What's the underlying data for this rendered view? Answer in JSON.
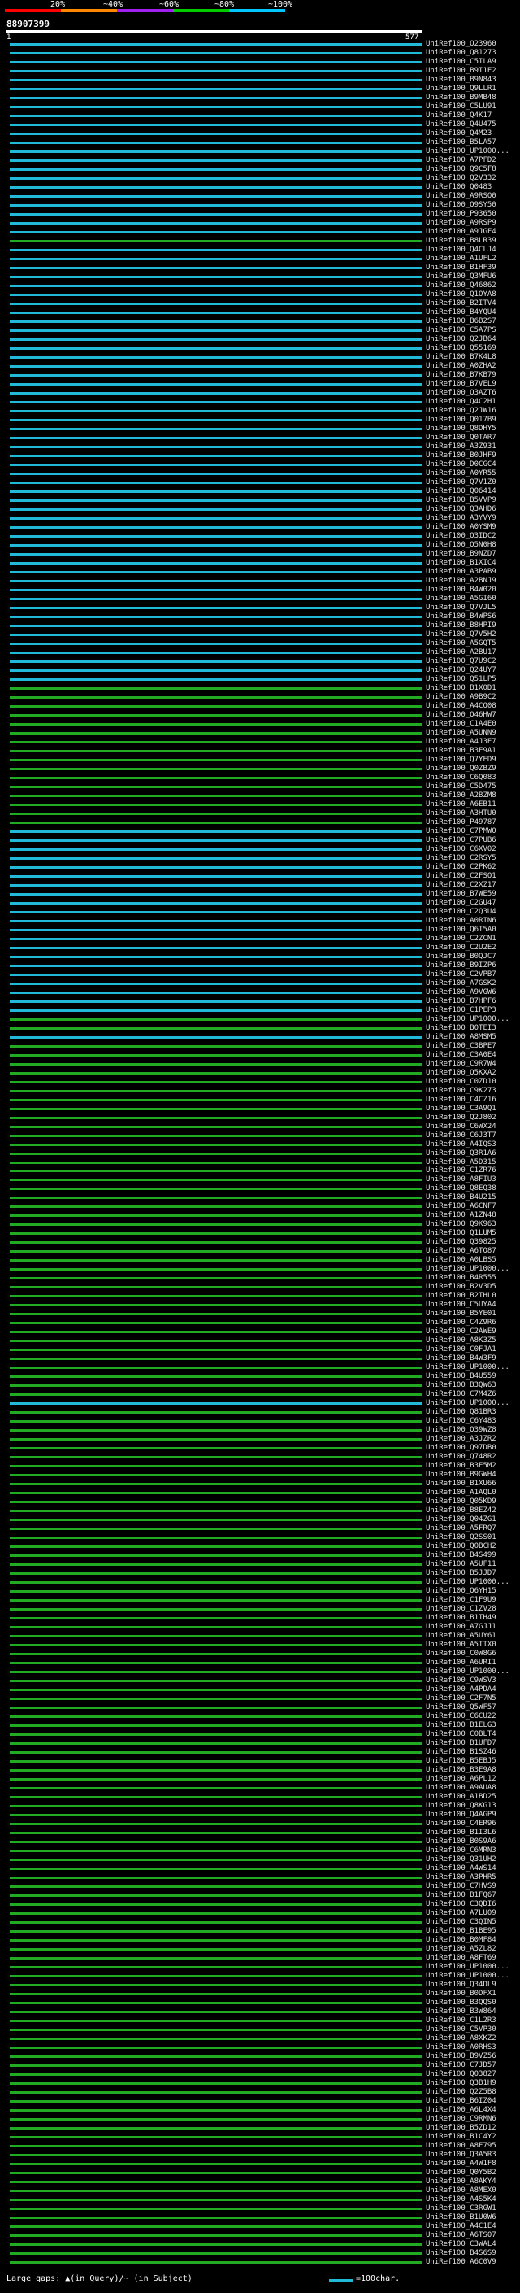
{
  "scale": {
    "ticks": [
      "20%",
      "~40%",
      "~60%",
      "~80%",
      "~100%"
    ],
    "colors": [
      "#ff0000",
      "#ff8800",
      "#a020f0",
      "#00cc00",
      "#00c8ff"
    ]
  },
  "query": {
    "id": "88907399",
    "start": "1",
    "end": "577"
  },
  "legend": {
    "gaps_text": "Large gaps: ▲(in Query)/~ (in Subject)",
    "char_text": "=100char."
  },
  "colors": {
    "cyan": "#22b8d8",
    "green": "#22aa22"
  },
  "hits": [
    {
      "name": "UniRef100_Q23960",
      "c": "c"
    },
    {
      "name": "UniRef100_Q81273",
      "c": "c"
    },
    {
      "name": "UniRef100_C5ILA9",
      "c": "c"
    },
    {
      "name": "UniRef100_B9I1E2",
      "c": "c"
    },
    {
      "name": "UniRef100_B9N843",
      "c": "c"
    },
    {
      "name": "UniRef100_Q9LLR1",
      "c": "c"
    },
    {
      "name": "UniRef100_B9MB48",
      "c": "c"
    },
    {
      "name": "UniRef100_C5LU91",
      "c": "c"
    },
    {
      "name": "UniRef100_Q4K17",
      "c": "c"
    },
    {
      "name": "UniRef100_Q4U475",
      "c": "c"
    },
    {
      "name": "UniRef100_Q4M23",
      "c": "c"
    },
    {
      "name": "UniRef100_B5LA57",
      "c": "c"
    },
    {
      "name": "UniRef100_UP1000...",
      "c": "c"
    },
    {
      "name": "UniRef100_A7PFD2",
      "c": "c"
    },
    {
      "name": "UniRef100_Q9C5F8",
      "c": "c"
    },
    {
      "name": "UniRef100_Q2V332",
      "c": "c"
    },
    {
      "name": "UniRef100_Q0483",
      "c": "c"
    },
    {
      "name": "UniRef100_A9RSQ0",
      "c": "c"
    },
    {
      "name": "UniRef100_Q9SY50",
      "c": "c"
    },
    {
      "name": "UniRef100_P93650",
      "c": "c"
    },
    {
      "name": "UniRef100_A9RSP9",
      "c": "c"
    },
    {
      "name": "UniRef100_A9JGF4",
      "c": "c"
    },
    {
      "name": "UniRef100_B8LR39",
      "c": "g"
    },
    {
      "name": "UniRef100_Q4CLJ4",
      "c": "c"
    },
    {
      "name": "UniRef100_A1UFL2",
      "c": "c"
    },
    {
      "name": "UniRef100_B1HF39",
      "c": "c"
    },
    {
      "name": "UniRef100_Q3MFU6",
      "c": "c"
    },
    {
      "name": "UniRef100_Q46862",
      "c": "c"
    },
    {
      "name": "UniRef100_Q1OYA8",
      "c": "c"
    },
    {
      "name": "UniRef100_B2ITV4",
      "c": "c"
    },
    {
      "name": "UniRef100_B4YQU4",
      "c": "c"
    },
    {
      "name": "UniRef100_B6B2S7",
      "c": "c"
    },
    {
      "name": "UniRef100_C5A7PS",
      "c": "c"
    },
    {
      "name": "UniRef100_Q2JB64",
      "c": "c"
    },
    {
      "name": "UniRef100_Q55169",
      "c": "c"
    },
    {
      "name": "UniRef100_B7K4L8",
      "c": "c"
    },
    {
      "name": "UniRef100_A0ZHA2",
      "c": "c"
    },
    {
      "name": "UniRef100_B7KB79",
      "c": "c"
    },
    {
      "name": "UniRef100_B7VEL9",
      "c": "c"
    },
    {
      "name": "UniRef100_Q3AZT6",
      "c": "c"
    },
    {
      "name": "UniRef100_Q4C2H1",
      "c": "c"
    },
    {
      "name": "UniRef100_Q2JW16",
      "c": "c"
    },
    {
      "name": "UniRef100_Q017B9",
      "c": "c"
    },
    {
      "name": "UniRef100_Q8DHY5",
      "c": "c"
    },
    {
      "name": "UniRef100_Q0TAR7",
      "c": "c"
    },
    {
      "name": "UniRef100_A3Z931",
      "c": "c"
    },
    {
      "name": "UniRef100_B0JHF9",
      "c": "c"
    },
    {
      "name": "UniRef100_D0CGC4",
      "c": "c"
    },
    {
      "name": "UniRef100_A0YR55",
      "c": "c"
    },
    {
      "name": "UniRef100_Q7V1Z0",
      "c": "c"
    },
    {
      "name": "UniRef100_Q06414",
      "c": "c"
    },
    {
      "name": "UniRef100_B5VVP9",
      "c": "c"
    },
    {
      "name": "UniRef100_Q3AHD6",
      "c": "c"
    },
    {
      "name": "UniRef100_A3YVY9",
      "c": "c"
    },
    {
      "name": "UniRef100_A0YSM9",
      "c": "c"
    },
    {
      "name": "UniRef100_Q3IDC2",
      "c": "c"
    },
    {
      "name": "UniRef100_Q5N0H8",
      "c": "c"
    },
    {
      "name": "UniRef100_B9NZD7",
      "c": "c"
    },
    {
      "name": "UniRef100_B1XIC4",
      "c": "c"
    },
    {
      "name": "UniRef100_A3PAB9",
      "c": "c"
    },
    {
      "name": "UniRef100_A2BNJ9",
      "c": "c"
    },
    {
      "name": "UniRef100_B4W020",
      "c": "c"
    },
    {
      "name": "UniRef100_A5GI60",
      "c": "c"
    },
    {
      "name": "UniRef100_Q7VJL5",
      "c": "c"
    },
    {
      "name": "UniRef100_B4WPS6",
      "c": "c"
    },
    {
      "name": "UniRef100_B8HPI9",
      "c": "c"
    },
    {
      "name": "UniRef100_Q7V5H2",
      "c": "c"
    },
    {
      "name": "UniRef100_A5GQT5",
      "c": "c"
    },
    {
      "name": "UniRef100_A2BU17",
      "c": "c"
    },
    {
      "name": "UniRef100_Q7U9C2",
      "c": "c"
    },
    {
      "name": "UniRef100_Q24UY7",
      "c": "c"
    },
    {
      "name": "UniRef100_Q51LP5",
      "c": "c"
    },
    {
      "name": "UniRef100_B1X0D1",
      "c": "g"
    },
    {
      "name": "UniRef100_A9B9C2",
      "c": "g"
    },
    {
      "name": "UniRef100_A4CQ08",
      "c": "g"
    },
    {
      "name": "UniRef100_Q46HW7",
      "c": "g"
    },
    {
      "name": "UniRef100_C1A4E0",
      "c": "g"
    },
    {
      "name": "UniRef100_A5UNN9",
      "c": "g"
    },
    {
      "name": "UniRef100_A4J3E7",
      "c": "g"
    },
    {
      "name": "UniRef100_B3E9A1",
      "c": "g"
    },
    {
      "name": "UniRef100_Q7YED9",
      "c": "g"
    },
    {
      "name": "UniRef100_Q0ZBZ9",
      "c": "g"
    },
    {
      "name": "UniRef100_C6Q083",
      "c": "g"
    },
    {
      "name": "UniRef100_C5D475",
      "c": "g"
    },
    {
      "name": "UniRef100_A2BZM8",
      "c": "g"
    },
    {
      "name": "UniRef100_A6EB11",
      "c": "g"
    },
    {
      "name": "UniRef100_A3HTU0",
      "c": "g"
    },
    {
      "name": "UniRef100_P49787",
      "c": "g"
    },
    {
      "name": "UniRef100_C7PMW0",
      "c": "c"
    },
    {
      "name": "UniRef100_C7PUB6",
      "c": "c"
    },
    {
      "name": "UniRef100_C6XV02",
      "c": "c"
    },
    {
      "name": "UniRef100_C2RSY5",
      "c": "c"
    },
    {
      "name": "UniRef100_C2PK62",
      "c": "c"
    },
    {
      "name": "UniRef100_C2FSQ1",
      "c": "c"
    },
    {
      "name": "UniRef100_C2XZ17",
      "c": "c"
    },
    {
      "name": "UniRef100_B7WE59",
      "c": "c"
    },
    {
      "name": "UniRef100_C2GU47",
      "c": "c"
    },
    {
      "name": "UniRef100_C2Q3U4",
      "c": "c"
    },
    {
      "name": "UniRef100_A0RIN6",
      "c": "c"
    },
    {
      "name": "UniRef100_Q6I5A0",
      "c": "c"
    },
    {
      "name": "UniRef100_C2ZCN1",
      "c": "c"
    },
    {
      "name": "UniRef100_C2U2E2",
      "c": "c"
    },
    {
      "name": "UniRef100_B0QJC7",
      "c": "c"
    },
    {
      "name": "UniRef100_B9IZP6",
      "c": "c"
    },
    {
      "name": "UniRef100_C2VPB7",
      "c": "c"
    },
    {
      "name": "UniRef100_A7GSK2",
      "c": "c"
    },
    {
      "name": "UniRef100_A9VGW6",
      "c": "c"
    },
    {
      "name": "UniRef100_B7HPF6",
      "c": "c"
    },
    {
      "name": "UniRef100_C1PEP3",
      "c": "c"
    },
    {
      "name": "UniRef100_UP1000...",
      "c": "g"
    },
    {
      "name": "UniRef100_B0TEI3",
      "c": "g"
    },
    {
      "name": "UniRef100_A8MSM5",
      "c": "c"
    },
    {
      "name": "UniRef100_C3BPE7",
      "c": "g"
    },
    {
      "name": "UniRef100_C3A0E4",
      "c": "g"
    },
    {
      "name": "UniRef100_C9R7W4",
      "c": "g"
    },
    {
      "name": "UniRef100_Q5KXA2",
      "c": "g"
    },
    {
      "name": "UniRef100_C0ZD10",
      "c": "g"
    },
    {
      "name": "UniRef100_C9K273",
      "c": "g"
    },
    {
      "name": "UniRef100_C4CZ16",
      "c": "g"
    },
    {
      "name": "UniRef100_C3A9Q1",
      "c": "g"
    },
    {
      "name": "UniRef100_Q2J802",
      "c": "g"
    },
    {
      "name": "UniRef100_C6WX24",
      "c": "g"
    },
    {
      "name": "UniRef100_C6J3T7",
      "c": "g"
    },
    {
      "name": "UniRef100_A4IQS3",
      "c": "g"
    },
    {
      "name": "UniRef100_Q3R1A6",
      "c": "g"
    },
    {
      "name": "UniRef100_A5D315",
      "c": "g"
    },
    {
      "name": "UniRef100_C1ZR76",
      "c": "g"
    },
    {
      "name": "UniRef100_A8FIU3",
      "c": "g"
    },
    {
      "name": "UniRef100_Q8EQ38",
      "c": "g"
    },
    {
      "name": "UniRef100_B4U215",
      "c": "g"
    },
    {
      "name": "UniRef100_A6CNF7",
      "c": "g"
    },
    {
      "name": "UniRef100_A1ZN48",
      "c": "g"
    },
    {
      "name": "UniRef100_Q9K963",
      "c": "g"
    },
    {
      "name": "UniRef100_Q1LUM5",
      "c": "g"
    },
    {
      "name": "UniRef100_Q39825",
      "c": "g"
    },
    {
      "name": "UniRef100_A6TQ87",
      "c": "g"
    },
    {
      "name": "UniRef100_A0LBS5",
      "c": "g"
    },
    {
      "name": "UniRef100_UP1000...",
      "c": "g"
    },
    {
      "name": "UniRef100_B4R555",
      "c": "g"
    },
    {
      "name": "UniRef100_B2V3D5",
      "c": "g"
    },
    {
      "name": "UniRef100_B2THL0",
      "c": "g"
    },
    {
      "name": "UniRef100_C5UYA4",
      "c": "g"
    },
    {
      "name": "UniRef100_B5YE01",
      "c": "g"
    },
    {
      "name": "UniRef100_C4Z9R6",
      "c": "g"
    },
    {
      "name": "UniRef100_C2AWE9",
      "c": "g"
    },
    {
      "name": "UniRef100_A8K3Z5",
      "c": "g"
    },
    {
      "name": "UniRef100_C0FJA1",
      "c": "g"
    },
    {
      "name": "UniRef100_B4W3F9",
      "c": "g"
    },
    {
      "name": "UniRef100_UP1000...",
      "c": "g"
    },
    {
      "name": "UniRef100_B4U559",
      "c": "g"
    },
    {
      "name": "UniRef100_B3QW63",
      "c": "g"
    },
    {
      "name": "UniRef100_C7M4Z6",
      "c": "g"
    },
    {
      "name": "UniRef100_UP1000...",
      "c": "c"
    },
    {
      "name": "UniRef100_Q81BR3",
      "c": "g"
    },
    {
      "name": "UniRef100_C6Y483",
      "c": "g"
    },
    {
      "name": "UniRef100_Q39WZ8",
      "c": "g"
    },
    {
      "name": "UniRef100_A3JZR2",
      "c": "g"
    },
    {
      "name": "UniRef100_Q97DB0",
      "c": "g"
    },
    {
      "name": "UniRef100_Q748R2",
      "c": "g"
    },
    {
      "name": "UniRef100_B3E5M2",
      "c": "g"
    },
    {
      "name": "UniRef100_B9GWH4",
      "c": "g"
    },
    {
      "name": "UniRef100_B1XU66",
      "c": "g"
    },
    {
      "name": "UniRef100_A1AQL0",
      "c": "g"
    },
    {
      "name": "UniRef100_Q05KD9",
      "c": "g"
    },
    {
      "name": "UniRef100_B8EZ42",
      "c": "g"
    },
    {
      "name": "UniRef100_Q04ZG1",
      "c": "g"
    },
    {
      "name": "UniRef100_A5FRQ7",
      "c": "g"
    },
    {
      "name": "UniRef100_Q2SS01",
      "c": "g"
    },
    {
      "name": "UniRef100_Q0BCH2",
      "c": "g"
    },
    {
      "name": "UniRef100_B4S499",
      "c": "g"
    },
    {
      "name": "UniRef100_A5UF11",
      "c": "g"
    },
    {
      "name": "UniRef100_B5JJD7",
      "c": "g"
    },
    {
      "name": "UniRef100_UP1000...",
      "c": "g"
    },
    {
      "name": "UniRef100_Q6YH15",
      "c": "g"
    },
    {
      "name": "UniRef100_C1F9U9",
      "c": "g"
    },
    {
      "name": "UniRef100_C1ZV28",
      "c": "g"
    },
    {
      "name": "UniRef100_B1TH49",
      "c": "g"
    },
    {
      "name": "UniRef100_A7GJJ1",
      "c": "g"
    },
    {
      "name": "UniRef100_A5UY61",
      "c": "g"
    },
    {
      "name": "UniRef100_A5ITX0",
      "c": "g"
    },
    {
      "name": "UniRef100_C0W8G6",
      "c": "g"
    },
    {
      "name": "UniRef100_A6URI1",
      "c": "g"
    },
    {
      "name": "UniRef100_UP1000...",
      "c": "g"
    },
    {
      "name": "UniRef100_C9WSV3",
      "c": "g"
    },
    {
      "name": "UniRef100_A4PDA4",
      "c": "g"
    },
    {
      "name": "UniRef100_C2F7N5",
      "c": "g"
    },
    {
      "name": "UniRef100_Q5WF57",
      "c": "g"
    },
    {
      "name": "UniRef100_C6CU22",
      "c": "g"
    },
    {
      "name": "UniRef100_B1ELG3",
      "c": "g"
    },
    {
      "name": "UniRef100_C0BLT4",
      "c": "g"
    },
    {
      "name": "UniRef100_B1UFD7",
      "c": "g"
    },
    {
      "name": "UniRef100_B1SZ46",
      "c": "g"
    },
    {
      "name": "UniRef100_B5EBJ5",
      "c": "g"
    },
    {
      "name": "UniRef100_B3E9A8",
      "c": "g"
    },
    {
      "name": "UniRef100_A6PL12",
      "c": "g"
    },
    {
      "name": "UniRef100_A9AUA8",
      "c": "g"
    },
    {
      "name": "UniRef100_A1BD25",
      "c": "g"
    },
    {
      "name": "UniRef100_Q8KG13",
      "c": "g"
    },
    {
      "name": "UniRef100_Q4AGP9",
      "c": "g"
    },
    {
      "name": "UniRef100_C4ER96",
      "c": "g"
    },
    {
      "name": "UniRef100_B1I3L6",
      "c": "g"
    },
    {
      "name": "UniRef100_B0S9A6",
      "c": "g"
    },
    {
      "name": "UniRef100_C6MRN3",
      "c": "g"
    },
    {
      "name": "UniRef100_Q31UH2",
      "c": "g"
    },
    {
      "name": "UniRef100_A4WS14",
      "c": "g"
    },
    {
      "name": "UniRef100_A3PHR5",
      "c": "g"
    },
    {
      "name": "UniRef100_C7HVS9",
      "c": "g"
    },
    {
      "name": "UniRef100_B1FQ67",
      "c": "g"
    },
    {
      "name": "UniRef100_C3QDI6",
      "c": "g"
    },
    {
      "name": "UniRef100_A7LU09",
      "c": "g"
    },
    {
      "name": "UniRef100_C3QIN5",
      "c": "g"
    },
    {
      "name": "UniRef100_B1BE95",
      "c": "g"
    },
    {
      "name": "UniRef100_B0MF84",
      "c": "g"
    },
    {
      "name": "UniRef100_A5ZL82",
      "c": "g"
    },
    {
      "name": "UniRef100_A8FT69",
      "c": "g"
    },
    {
      "name": "UniRef100_UP1000...",
      "c": "g"
    },
    {
      "name": "UniRef100_UP1000...",
      "c": "g"
    },
    {
      "name": "UniRef100_Q34DL9",
      "c": "g"
    },
    {
      "name": "UniRef100_B0DFX1",
      "c": "g"
    },
    {
      "name": "UniRef100_B3QQS0",
      "c": "g"
    },
    {
      "name": "UniRef100_B3W864",
      "c": "g"
    },
    {
      "name": "UniRef100_C1L2R3",
      "c": "g"
    },
    {
      "name": "UniRef100_C5VP30",
      "c": "g"
    },
    {
      "name": "UniRef100_A8XKZ2",
      "c": "g"
    },
    {
      "name": "UniRef100_A0RHS3",
      "c": "g"
    },
    {
      "name": "UniRef100_B9VZ56",
      "c": "g"
    },
    {
      "name": "UniRef100_C7JD57",
      "c": "g"
    },
    {
      "name": "UniRef100_Q03827",
      "c": "g"
    },
    {
      "name": "UniRef100_Q3B1H9",
      "c": "g"
    },
    {
      "name": "UniRef100_Q2Z5B8",
      "c": "g"
    },
    {
      "name": "UniRef100_B6IZ04",
      "c": "g"
    },
    {
      "name": "UniRef100_A6L4X4",
      "c": "g"
    },
    {
      "name": "UniRef100_C9RMN6",
      "c": "g"
    },
    {
      "name": "UniRef100_B5ZD12",
      "c": "g"
    },
    {
      "name": "UniRef100_B1C4Y2",
      "c": "g"
    },
    {
      "name": "UniRef100_A8E795",
      "c": "g"
    },
    {
      "name": "UniRef100_Q3A5R3",
      "c": "g"
    },
    {
      "name": "UniRef100_A4W1F8",
      "c": "g"
    },
    {
      "name": "UniRef100_Q0Y5B2",
      "c": "g"
    },
    {
      "name": "UniRef100_A8AKY4",
      "c": "g"
    },
    {
      "name": "UniRef100_A8MEX0",
      "c": "g"
    },
    {
      "name": "UniRef100_A4S5K4",
      "c": "g"
    },
    {
      "name": "UniRef100_C3RGW1",
      "c": "g"
    },
    {
      "name": "UniRef100_B1U0W6",
      "c": "g"
    },
    {
      "name": "UniRef100_A4C1E4",
      "c": "g"
    },
    {
      "name": "UniRef100_A6TS07",
      "c": "g"
    },
    {
      "name": "UniRef100_C3WAL4",
      "c": "g"
    },
    {
      "name": "UniRef100_B4S6S9",
      "c": "g"
    },
    {
      "name": "UniRef100_A6C0V9",
      "c": "g"
    }
  ]
}
